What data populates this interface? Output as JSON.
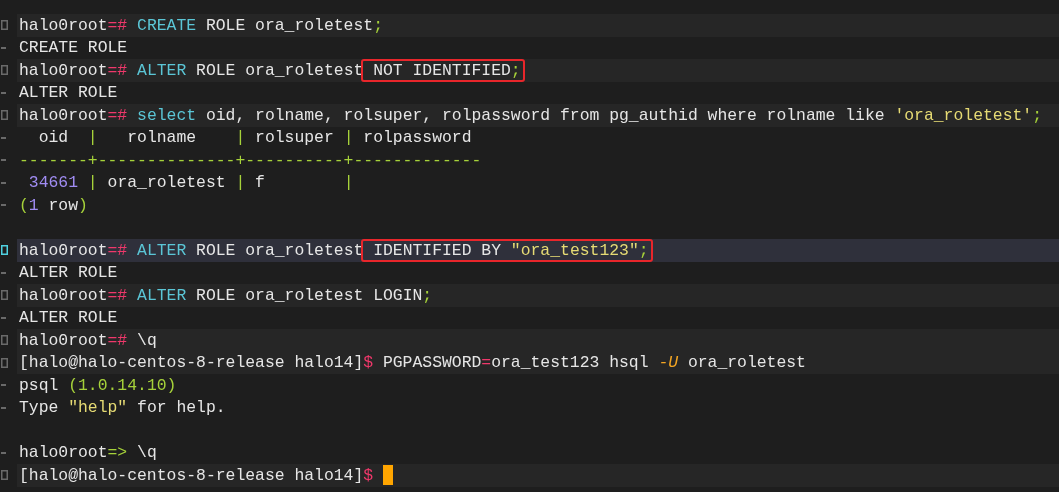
{
  "terminal": {
    "lines": [
      {
        "kind": "command",
        "selected": false,
        "cursor": false,
        "chunks": [
          {
            "boxed": false,
            "segments": [
              {
                "text": "halo0root"
              },
              {
                "text": "=#",
                "color": "#f0386b"
              },
              {
                "text": " CREATE",
                "color": "#5bc6d6"
              },
              {
                "text": " ROLE ora_roletest"
              },
              {
                "text": ";",
                "color": "#a6d23a"
              }
            ]
          }
        ]
      },
      {
        "kind": "output",
        "selected": false,
        "cursor": false,
        "chunks": [
          {
            "boxed": false,
            "segments": [
              {
                "text": "CREATE ROLE"
              }
            ]
          }
        ]
      },
      {
        "kind": "command",
        "selected": false,
        "cursor": false,
        "chunks": [
          {
            "boxed": false,
            "segments": [
              {
                "text": "halo0root"
              },
              {
                "text": "=#",
                "color": "#f0386b"
              },
              {
                "text": " ALTER",
                "color": "#5bc6d6"
              },
              {
                "text": " ROLE ora_roletest"
              }
            ]
          },
          {
            "boxed": true,
            "segments": [
              {
                "text": " NOT IDENTIFIED"
              },
              {
                "text": ";",
                "color": "#a6d23a"
              }
            ]
          }
        ]
      },
      {
        "kind": "output",
        "selected": false,
        "cursor": false,
        "chunks": [
          {
            "boxed": false,
            "segments": [
              {
                "text": "ALTER ROLE"
              }
            ]
          }
        ]
      },
      {
        "kind": "command",
        "selected": false,
        "cursor": false,
        "chunks": [
          {
            "boxed": false,
            "segments": [
              {
                "text": "halo0root"
              },
              {
                "text": "=#",
                "color": "#f0386b"
              },
              {
                "text": " select",
                "color": "#5bc6d6"
              },
              {
                "text": " oid, rolname, rolsuper, rolpassword from pg_authid where rolname like "
              },
              {
                "text": "'ora_roletest'",
                "color": "#e6db74"
              },
              {
                "text": ";",
                "color": "#a6d23a"
              }
            ]
          }
        ]
      },
      {
        "kind": "output",
        "selected": false,
        "cursor": false,
        "chunks": [
          {
            "boxed": false,
            "segments": [
              {
                "text": "  oid  "
              },
              {
                "text": "|",
                "color": "#a6d23a"
              },
              {
                "text": "   rolname    "
              },
              {
                "text": "|",
                "color": "#a6d23a"
              },
              {
                "text": " rolsuper "
              },
              {
                "text": "|",
                "color": "#a6d23a"
              },
              {
                "text": " rolpassword"
              }
            ]
          }
        ]
      },
      {
        "kind": "output",
        "selected": false,
        "cursor": false,
        "chunks": [
          {
            "boxed": false,
            "segments": [
              {
                "text": "-------+--------------+----------+-------------",
                "color": "#a6d23a"
              }
            ]
          }
        ]
      },
      {
        "kind": "output",
        "selected": false,
        "cursor": false,
        "chunks": [
          {
            "boxed": false,
            "segments": [
              {
                "text": " 34661",
                "color": "#a08cf2"
              },
              {
                "text": " |",
                "color": "#a6d23a"
              },
              {
                "text": " ora_roletest "
              },
              {
                "text": "|",
                "color": "#a6d23a"
              },
              {
                "text": " f        "
              },
              {
                "text": "|",
                "color": "#a6d23a"
              }
            ]
          }
        ]
      },
      {
        "kind": "output",
        "selected": false,
        "cursor": false,
        "chunks": [
          {
            "boxed": false,
            "segments": [
              {
                "text": "(",
                "color": "#a6d23a"
              },
              {
                "text": "1",
                "color": "#a08cf2"
              },
              {
                "text": " row"
              },
              {
                "text": ")",
                "color": "#a6d23a"
              }
            ]
          }
        ]
      },
      {
        "kind": "blank",
        "selected": false,
        "cursor": false
      },
      {
        "kind": "command",
        "selected": true,
        "cursor": false,
        "chunks": [
          {
            "boxed": false,
            "segments": [
              {
                "text": "halo0root"
              },
              {
                "text": "=#",
                "color": "#f0386b"
              },
              {
                "text": " ALTER",
                "color": "#5bc6d6"
              },
              {
                "text": " ROLE ora_roletest"
              }
            ]
          },
          {
            "boxed": true,
            "segments": [
              {
                "text": " IDENTIFIED BY "
              },
              {
                "text": "\"ora_test123\"",
                "color": "#e6db74"
              },
              {
                "text": ";",
                "color": "#a6d23a"
              }
            ]
          }
        ]
      },
      {
        "kind": "output",
        "selected": false,
        "cursor": false,
        "chunks": [
          {
            "boxed": false,
            "segments": [
              {
                "text": "ALTER ROLE"
              }
            ]
          }
        ]
      },
      {
        "kind": "command",
        "selected": false,
        "cursor": false,
        "chunks": [
          {
            "boxed": false,
            "segments": [
              {
                "text": "halo0root"
              },
              {
                "text": "=#",
                "color": "#f0386b"
              },
              {
                "text": " ALTER",
                "color": "#5bc6d6"
              },
              {
                "text": " ROLE ora_roletest LOGIN"
              },
              {
                "text": ";",
                "color": "#a6d23a"
              }
            ]
          }
        ]
      },
      {
        "kind": "output",
        "selected": false,
        "cursor": false,
        "chunks": [
          {
            "boxed": false,
            "segments": [
              {
                "text": "ALTER ROLE"
              }
            ]
          }
        ]
      },
      {
        "kind": "command",
        "selected": false,
        "cursor": false,
        "chunks": [
          {
            "boxed": false,
            "segments": [
              {
                "text": "halo0root"
              },
              {
                "text": "=#",
                "color": "#f0386b"
              },
              {
                "text": " \\q"
              }
            ]
          }
        ]
      },
      {
        "kind": "command",
        "selected": false,
        "cursor": false,
        "chunks": [
          {
            "boxed": false,
            "segments": [
              {
                "text": "[halo@halo-centos-8-release halo14]"
              },
              {
                "text": "$",
                "color": "#f0386b"
              },
              {
                "text": " PGPASSWORD"
              },
              {
                "text": "=",
                "color": "#f0386b"
              },
              {
                "text": "ora_test123 hsql "
              },
              {
                "text": "-U",
                "color": "#f5a623",
                "italic": true
              },
              {
                "text": " ora_roletest"
              }
            ]
          }
        ]
      },
      {
        "kind": "output",
        "selected": false,
        "cursor": false,
        "chunks": [
          {
            "boxed": false,
            "segments": [
              {
                "text": "psql "
              },
              {
                "text": "(1.0.14.10)",
                "color": "#a6d23a"
              }
            ]
          }
        ]
      },
      {
        "kind": "output",
        "selected": false,
        "cursor": false,
        "chunks": [
          {
            "boxed": false,
            "segments": [
              {
                "text": "Type "
              },
              {
                "text": "\"help\"",
                "color": "#e6db74"
              },
              {
                "text": " for help."
              }
            ]
          }
        ]
      },
      {
        "kind": "blank",
        "selected": false,
        "cursor": false
      },
      {
        "kind": "output",
        "selected": false,
        "cursor": false,
        "chunks": [
          {
            "boxed": false,
            "segments": [
              {
                "text": "halo0root"
              },
              {
                "text": "=>",
                "color": "#a6d23a"
              },
              {
                "text": " \\q"
              }
            ]
          }
        ]
      },
      {
        "kind": "command",
        "selected": false,
        "cursor": true,
        "chunks": [
          {
            "boxed": false,
            "segments": [
              {
                "text": "[halo@halo-centos-8-release halo14]"
              },
              {
                "text": "$ ",
                "color": "#f0386b"
              }
            ]
          }
        ]
      }
    ]
  }
}
